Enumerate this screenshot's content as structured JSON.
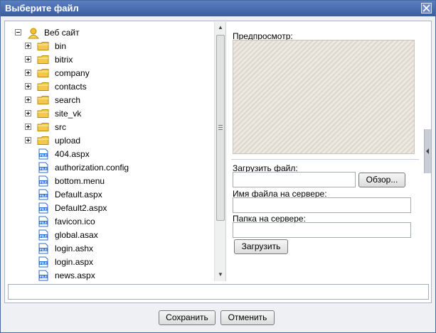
{
  "title": "Выберите файл",
  "tree": {
    "root": {
      "label": "Веб сайт"
    },
    "folders": [
      {
        "label": "bin"
      },
      {
        "label": "bitrix"
      },
      {
        "label": "company"
      },
      {
        "label": "contacts"
      },
      {
        "label": "search"
      },
      {
        "label": "site_vk"
      },
      {
        "label": "src"
      },
      {
        "label": "upload"
      }
    ],
    "files": [
      {
        "label": "404.aspx"
      },
      {
        "label": "authorization.config"
      },
      {
        "label": "bottom.menu"
      },
      {
        "label": "Default.aspx"
      },
      {
        "label": "Default2.aspx"
      },
      {
        "label": "favicon.ico"
      },
      {
        "label": "global.asax"
      },
      {
        "label": "login.ashx"
      },
      {
        "label": "login.aspx"
      },
      {
        "label": "news.aspx"
      }
    ],
    "file_icon_text": "FILE"
  },
  "right": {
    "preview_label": "Предпросмотр:",
    "upload_label": "Загрузить файл:",
    "upload_value": "",
    "browse_button": "Обзор...",
    "server_name_label": "Имя файла на сервере:",
    "server_name_value": "",
    "server_folder_label": "Папка на сервере:",
    "server_folder_value": "",
    "upload_button": "Загрузить"
  },
  "path_value": "",
  "footer": {
    "save_button": "Сохранить",
    "cancel_button": "Отменить"
  },
  "colors": {
    "titlebar": "#3f63a6",
    "folder": "#f2c94c",
    "file_icon": "#2a6fd0"
  }
}
